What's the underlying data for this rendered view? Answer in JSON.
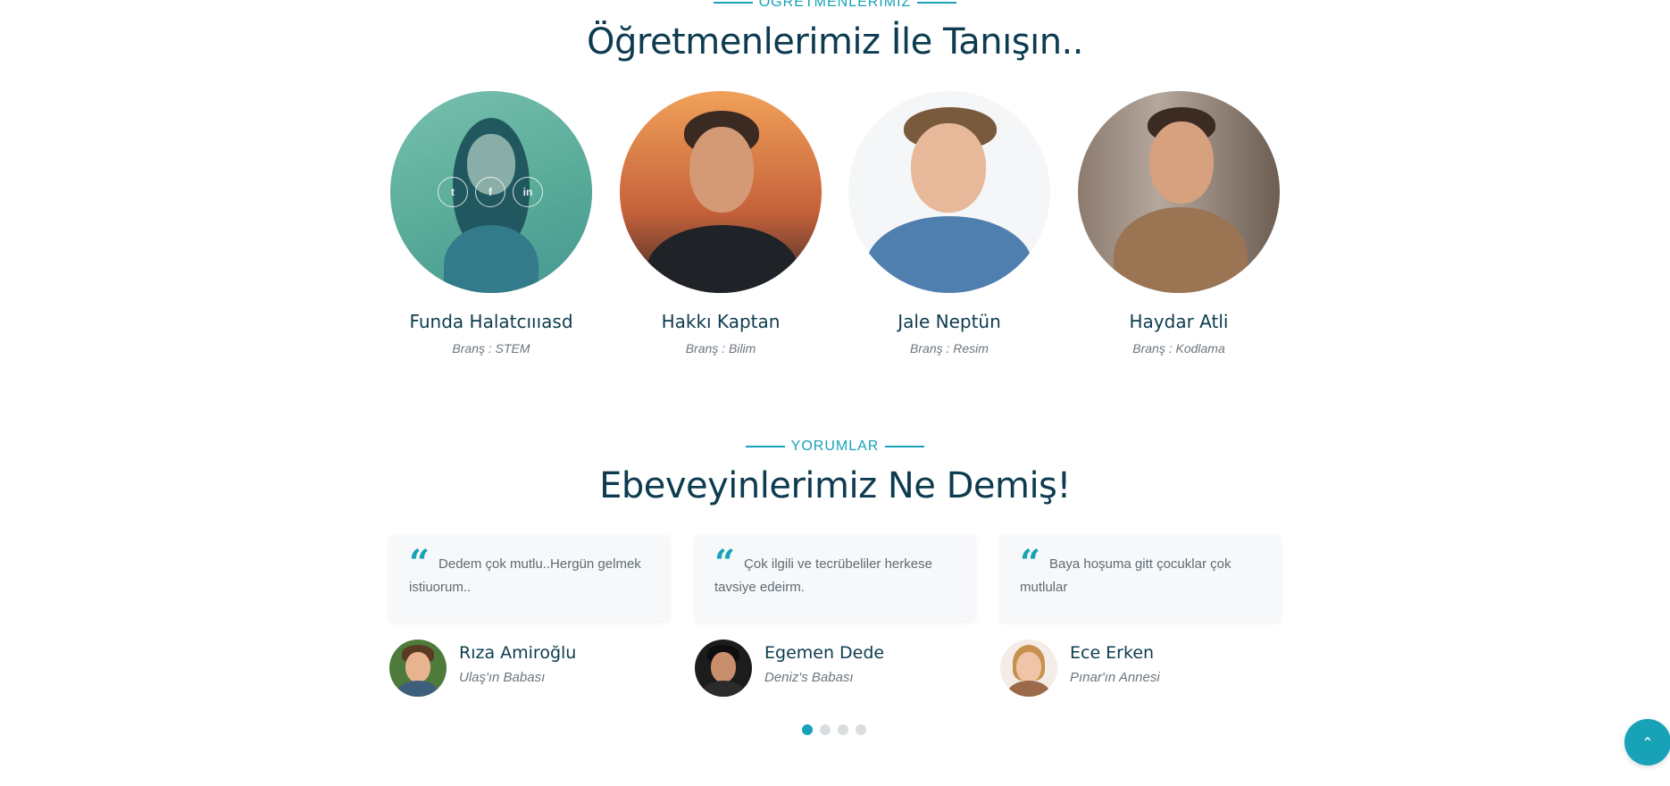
{
  "teachers_section": {
    "eyebrow": "ÖĞRETMENLERİMİZ",
    "title": "Öğretmenlerimiz İle Tanışın..",
    "teachers": [
      {
        "name": "Funda Halatcıııasd",
        "branch": "Branş : STEM"
      },
      {
        "name": "Hakkı Kaptan",
        "branch": "Branş : Bilim"
      },
      {
        "name": "Jale Neptün",
        "branch": "Branş : Resim"
      },
      {
        "name": "Haydar Atli",
        "branch": "Branş : Kodlama"
      }
    ],
    "social_icons": [
      "twitter-icon",
      "facebook-icon",
      "linkedin-icon"
    ]
  },
  "testimonials_section": {
    "eyebrow": "YORUMLAR",
    "title": "Ebeveyinlerimiz Ne Demiş!",
    "items": [
      {
        "text": "Dedem çok mutlu..Hergün gelmek istiuorum..",
        "author": "Rıza Amiroğlu",
        "role": "Ulaş'ın Babası"
      },
      {
        "text": "Çok ilgili ve tecrübeliler herkese tavsiye edeirm.",
        "author": "Egemen Dede",
        "role": "Deniz's Babası"
      },
      {
        "text": "Baya hoşuma gitt çocuklar çok mutlular",
        "author": "Ece Erken",
        "role": "Pınar'ın Annesi"
      }
    ],
    "carousel": {
      "pages": 4,
      "active_page": 1
    }
  },
  "back_to_top": {
    "icon": "double-chevron-up-icon",
    "glyph": "⌃"
  },
  "colors": {
    "accent": "#17a2b8",
    "heading": "#0d3b4f",
    "text": "#6c757d"
  }
}
